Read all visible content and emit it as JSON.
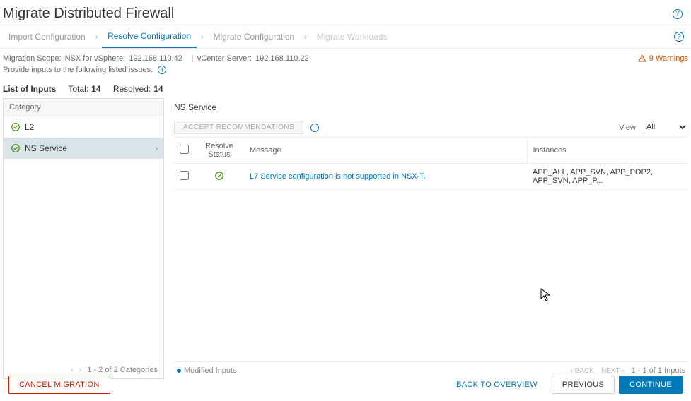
{
  "header": {
    "title": "Migrate Distributed Firewall"
  },
  "wizard": {
    "steps": [
      "Import Configuration",
      "Resolve Configuration",
      "Migrate Configuration",
      "Migrate Workloads"
    ],
    "active_index": 1,
    "disabled_index": 3
  },
  "scope": {
    "label": "Migration Scope:",
    "product_label": "NSX for vSphere:",
    "product_ip": "192.168.110.42",
    "vcenter_label": "vCenter Server:",
    "vcenter_ip": "192.168.110.22",
    "warnings_count": "9 Warnings"
  },
  "provide_text": "Provide inputs to the following listed issues.",
  "summary": {
    "list_label": "List of Inputs",
    "total_label": "Total:",
    "total_value": "14",
    "resolved_label": "Resolved:",
    "resolved_value": "14"
  },
  "categories": {
    "header": "Category",
    "items": [
      {
        "label": "L2",
        "selected": false
      },
      {
        "label": "NS Service",
        "selected": true
      }
    ],
    "footer": "1 - 2 of 2 Categories"
  },
  "detail": {
    "title": "NS Service",
    "accept_button": "ACCEPT RECOMMENDATIONS",
    "view_label": "View:",
    "view_value": "All",
    "columns": [
      "",
      "Resolve Status",
      "Message",
      "Instances"
    ],
    "rows": [
      {
        "status": "ok",
        "message": "L7 Service configuration is not supported in NSX-T.",
        "instances": "APP_ALL, APP_SVN, APP_POP2, APP_SVN, APP_P..."
      }
    ],
    "legend": "Modified Inputs",
    "pager_back": "BACK",
    "pager_next": "NEXT",
    "pager_status": "1 - 1 of 1 Inputs"
  },
  "footer": {
    "cancel": "CANCEL MIGRATION",
    "back_overview": "BACK TO OVERVIEW",
    "previous": "PREVIOUS",
    "continue": "CONTINUE"
  }
}
